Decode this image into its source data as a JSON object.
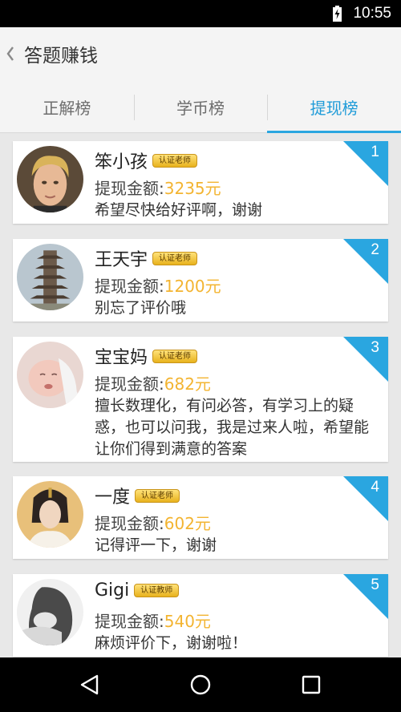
{
  "status_bar": {
    "time": "10:55"
  },
  "header": {
    "title": "答题赚钱"
  },
  "tabs": [
    {
      "label": "正解榜",
      "active": false
    },
    {
      "label": "学币榜",
      "active": false
    },
    {
      "label": "提现榜",
      "active": true
    }
  ],
  "colors": {
    "accent": "#2aa6e0",
    "amount": "#f3b431",
    "badge": "#f5c842"
  },
  "amount_label": "提现金额:",
  "entries": [
    {
      "rank": "1",
      "name": "笨小孩",
      "badge": "认证老师",
      "amount": "3235元",
      "message": "希望尽快给好评啊，谢谢",
      "avatar_icon": "portrait-avatar-icon"
    },
    {
      "rank": "2",
      "name": "王天宇",
      "badge": "认证老师",
      "amount": "1200元",
      "message": "别忘了评价哦",
      "avatar_icon": "pagoda-avatar-icon"
    },
    {
      "rank": "3",
      "name": "宝宝妈",
      "badge": "认证老师",
      "amount": "682元",
      "message": "擅长数理化，有问必答，有学习上的疑惑，也可以问我，我是过来人啦，希望能让你们得到满意的答案",
      "avatar_icon": "baby-avatar-icon"
    },
    {
      "rank": "4",
      "name": "一度",
      "badge": "认证老师",
      "amount": "602元",
      "message": "记得评一下，谢谢",
      "avatar_icon": "costume-avatar-icon"
    },
    {
      "rank": "5",
      "name": "Gigi",
      "badge": "认证教师",
      "amount": "540元",
      "message": "麻烦评价下，谢谢啦！",
      "avatar_icon": "grayscale-avatar-icon"
    }
  ]
}
